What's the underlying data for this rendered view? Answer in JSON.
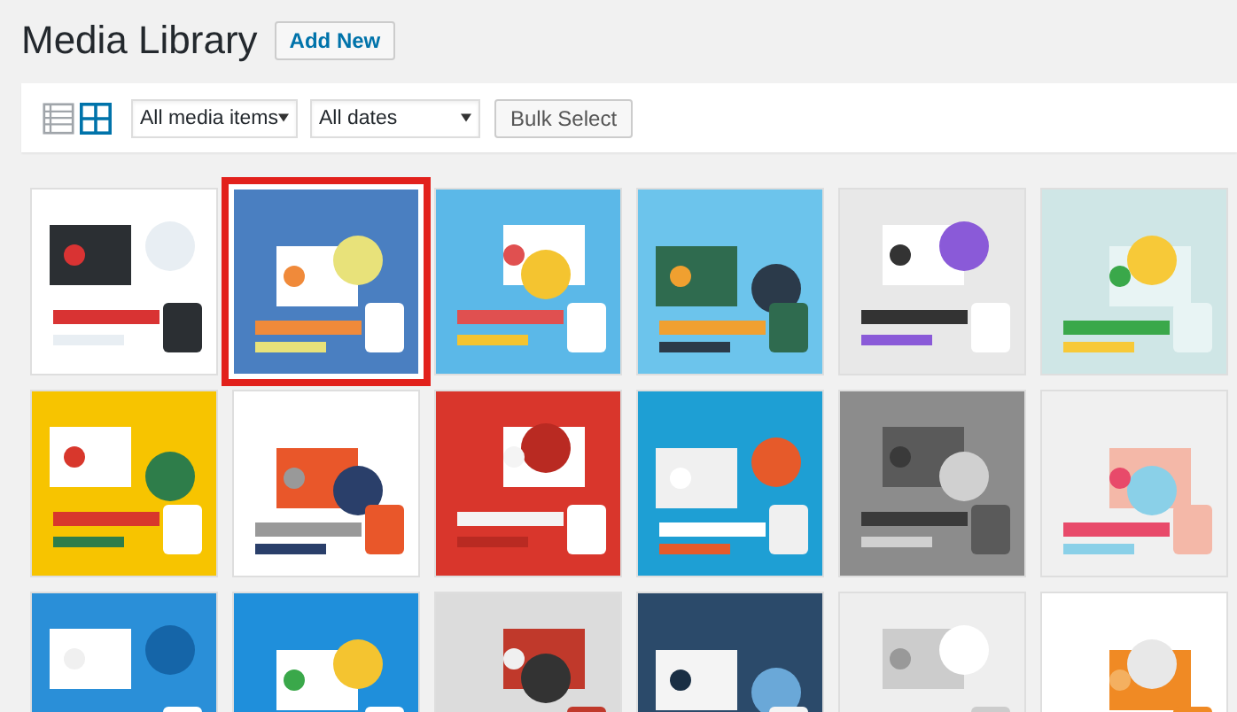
{
  "page_title": "Media Library",
  "add_new_button": "Add New",
  "toolbar": {
    "views": [
      {
        "kind": "list",
        "selected": false
      },
      {
        "kind": "grid",
        "selected": true
      }
    ],
    "type_filter": "All media items",
    "date_filter": "All dates",
    "bulk_select_button": "Bulk Select"
  },
  "media": [
    {
      "kind": "picture",
      "selected": false
    },
    {
      "kind": "picture",
      "selected": true
    },
    {
      "kind": "picture",
      "selected": false
    },
    {
      "kind": "picture",
      "selected": false
    },
    {
      "kind": "picture",
      "selected": false
    },
    {
      "kind": "picture",
      "selected": false
    },
    {
      "kind": "picture",
      "selected": false
    },
    {
      "kind": "picture",
      "selected": false
    },
    {
      "kind": "picture",
      "selected": false
    },
    {
      "kind": "picture",
      "selected": false
    },
    {
      "kind": "picture",
      "selected": false
    },
    {
      "kind": "picture",
      "selected": false
    },
    {
      "kind": "picture",
      "selected": false
    },
    {
      "kind": "picture",
      "selected": false
    },
    {
      "kind": "picture",
      "selected": false
    },
    {
      "kind": "picture",
      "selected": false
    },
    {
      "kind": "picture",
      "selected": false
    },
    {
      "kind": "picture",
      "selected": false
    }
  ]
}
